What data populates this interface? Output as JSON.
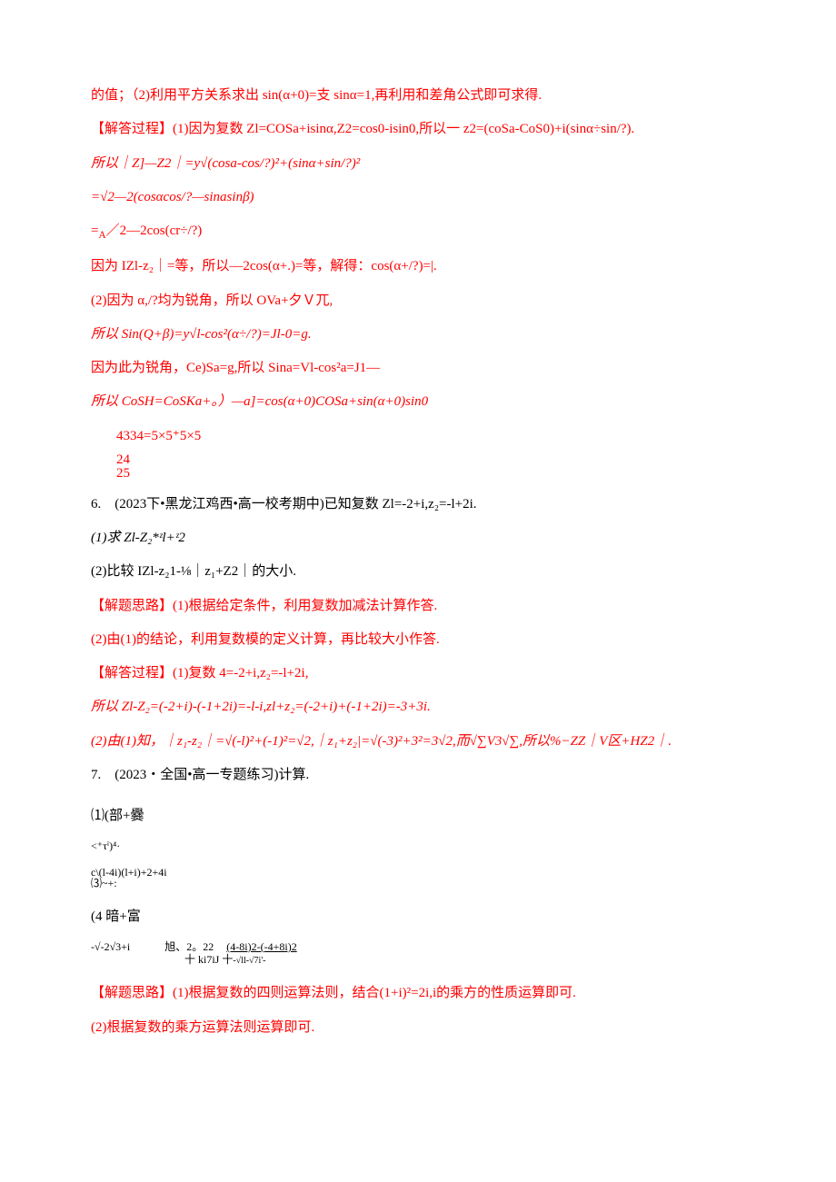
{
  "lines": {
    "l1": "的值；（2)利用平方关系求出 sin(α+0)=支 sinα=1,再利用和差角公式即可求得.",
    "l2": "【解答过程】(1)因为复数 Zl=COSa+isinα,Z2=cos0-isin0,所以一 z2=(coSa-CoS0)+i(sinα÷sin/?).",
    "l3": "所以｜Z]—Z2｜=y√(cosa-cos/?)²+(sinα+sin/?)²",
    "l4": "=√2—2(cosαcos/?—sinasinβ)",
    "l5a": "=",
    "l5b": "A",
    "l5c": "／2—2cos(cr÷/?)",
    "l6": "因为 IZl-z₂｜=等，所以—2cos(α+.)=等，解得：cos(α+/?)=|.",
    "l7": "(2)因为 α,/?均为锐角，所以 OVa+夕Ｖ兀,",
    "l8": "所以 Sin(Q+β)=y√l-cos²(α÷/?)=Jl-0=g.",
    "l9": "因为此为锐角，Ce)Sa=g,所以 Sina=Vl-cos²a=J1—",
    "l10": "所以 CoSH=CoSKa+。）—a]=cos(α+0)COSa+sin(α+0)sin0",
    "l11a": "4334=5×5⁺5×5",
    "l11b": "24",
    "l11c": "25",
    "l12": "6.　(2023下•黑龙江鸡西•高一校考期中)已知复数 Zl=-2+i,z₂=-l+2i.",
    "l13": "(1)求 Zl-Z₂*ᶻl+ᶻ2",
    "l14": "(2)比较 IZl-z₂1-⅛｜z₁+Z2｜的大小.",
    "l15": "【解题思路】(1)根据给定条件，利用复数加减法计算作答.",
    "l16": "(2)由(1)的结论，利用复数模的定义计算，再比较大小作答.",
    "l17": "【解答过程】(1)复数 4=-2+i,z₂=-l+2i,",
    "l18": "所以 Zl-Z₂=(-2+i)-(-1+2i)=-l-i,zl+z₂=(-2+i)+(-1+2i)=-3+3i.",
    "l19": "(2)由(1)知，｜z₁-z₂｜=√(-l)²+(-1)²=√2,｜z₁+z₂|=√(-3)²+3²=3√2,而√∑V3√∑,所以%−ZZ｜V区+HZ2｜.",
    "l20": "7.　(2023・全国•高一专题练习)计算.",
    "l21": "⑴(部+爨",
    "l22": "<⁺τⁱ)⁴·",
    "l23a": "c\\(l-4i)(l+i)+2+4i",
    "l23b": "⑶~+:",
    "l24": "(4 暗+富",
    "l25a": "-√-2√3+i",
    "l25b": "旭、2。22",
    "l25c": "(4-8i)2-(-4+8i)2",
    "l25d": "十 ki7iJ 十",
    "l25e": "-√ll-√7i'-",
    "l26": "【解题思路】(1)根据复数的四则运算法则，结合(1+i)²=2i,i的乘方的性质运算即可.",
    "l27": "(2)根据复数的乘方运算法则运算即可."
  }
}
